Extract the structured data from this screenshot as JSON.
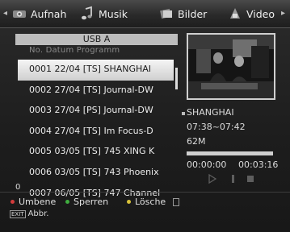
{
  "tabs": [
    {
      "label": "Aufnah",
      "icon": "record-icon"
    },
    {
      "label": "Musik",
      "icon": "music-icon"
    },
    {
      "label": "Bilder",
      "icon": "pictures-icon"
    },
    {
      "label": "Video",
      "icon": "video-icon"
    }
  ],
  "list": {
    "header": "USB A",
    "columns": "No.  Datum  Programm",
    "selected_index": 0,
    "rows": [
      "0001 22/04  [TS] SHANGHAI",
      "0002 27/04  [TS] Journal-DW",
      "0003 27/04  [PS] Journal-DW",
      "0004 27/04  [TS] Im Focus-D",
      "0005 03/05  [TS] 745 XING K",
      "0006 03/05  [TS] 743 Phoenix",
      "0007 06/05  [TS] 747 Channel"
    ],
    "page": "0"
  },
  "preview": {
    "title": "SHANGHAI",
    "time_range": "07:38~07:42",
    "size": "62M",
    "elapsed": "00:00:00",
    "duration": "00:03:16",
    "progress": 0.0
  },
  "footer": {
    "items": [
      {
        "label": "Umbene",
        "color": "#d23b3b"
      },
      {
        "label": "Sperren",
        "color": "#3fae3f"
      },
      {
        "label": "Lösche",
        "color": "#d8c23a"
      }
    ],
    "exit_key": "EXIT",
    "exit_label": "Abbr."
  }
}
